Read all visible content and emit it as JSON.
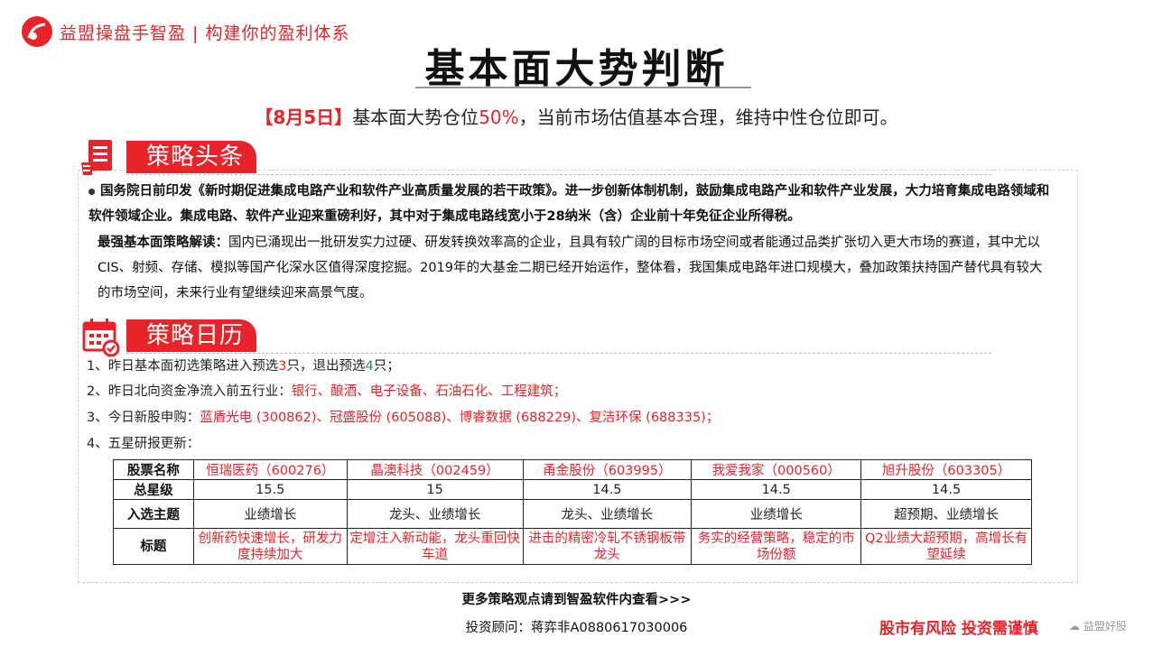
{
  "header": {
    "brand": "益盟操盘手智盈 | 构建你的盈利体系",
    "title": "基本面大势判断"
  },
  "summary": {
    "date": "【8月5日】",
    "text_a": "基本面大势仓位",
    "position": "50%",
    "text_b": "，当前市场估值基本合理，维持中性仓位即可。"
  },
  "section_headline": {
    "tab_label": "策略头条",
    "news": "国务院日前印发《新时期促进集成电路产业和软件产业高质量发展的若干政策》。进一步创新体制机制，鼓励集成电路产业和软件产业发展，大力培育集成电路领域和软件领域企业。集成电路、软件产业迎来重磅利好，其中对于集成电路线宽小于28纳米（含）企业前十年免征企业所得税。",
    "reading_label": "最强基本面策略解读：",
    "reading": "国内已涌现出一批研发实力过硬、研发转换效率高的企业，且具有较广阔的目标市场空间或者能通过品类扩张切入更大市场的赛道，其中尤以CIS、射频、存储、模拟等国产化深水区值得深度挖掘。2019年的大基金二期已经开始运作，整体看，我国集成电路年进口规模大，叠加政策扶持国产替代具有较大的市场空间，未来行业有望继续迎来高景气度。"
  },
  "section_calendar": {
    "tab_label": "策略日历",
    "item1_a": "1、昨日基本面初选策略进入预选",
    "item1_in": "3",
    "item1_b": "只，退出预选",
    "item1_out": "4",
    "item1_c": "只；",
    "item2_a": "2、昨日北向资金净流入前五行业：",
    "item2_b": "银行、酿酒、电子设备、石油石化、工程建筑；",
    "item3_a": "3、今日新股申购：",
    "item3_b": "蓝盾光电 (300862)、冠盛股份 (605088)、博睿数据 (688229)、复洁环保 (688335)；",
    "item4": "4、五星研报更新："
  },
  "table": {
    "headers": [
      "股票名称",
      "总星级",
      "入选主题",
      "标题"
    ],
    "stocks": [
      {
        "name": "恒瑞医药（600276）",
        "stars": "15.5",
        "theme": "业绩增长",
        "title": "创新药快速增长，研发力度持续加大"
      },
      {
        "name": "晶澳科技（002459）",
        "stars": "15",
        "theme": "龙头、业绩增长",
        "title": "定增注入新动能，龙头重回快车道"
      },
      {
        "name": "甬金股份（603995）",
        "stars": "14.5",
        "theme": "龙头、业绩增长",
        "title": "进击的精密冷轧不锈钢板带龙头"
      },
      {
        "name": "我爱我家（000560）",
        "stars": "14.5",
        "theme": "业绩增长",
        "title": "务实的经营策略，稳定的市场份额"
      },
      {
        "name": "旭升股份（603305）",
        "stars": "14.5",
        "theme": "超预期、业绩增长",
        "title": "Q2业绩大超预期，高增长有望延续"
      }
    ]
  },
  "footer": {
    "more": "更多策略观点请到智盈软件内查看>>>",
    "advisor": "投资顾问：蒋弈非A0880617030006",
    "risk": "股市有风险  投资需谨慎",
    "wechat": "益盟好股"
  },
  "colors": {
    "accent": "#e8232a",
    "up": "#1a9c3c"
  }
}
